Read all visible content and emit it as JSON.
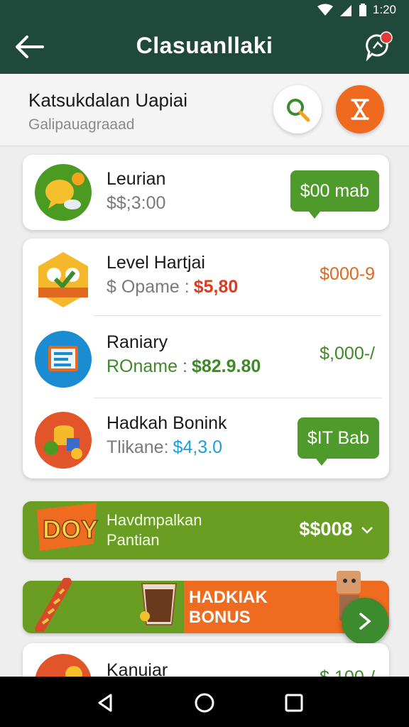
{
  "status_bar": {
    "time": "1:20",
    "icons": [
      "wifi-icon",
      "signal-icon",
      "battery-icon"
    ]
  },
  "app_bar": {
    "title": "Clasuanllaki",
    "back_icon": "back-arrow-icon",
    "action_icon": "chat-notification-icon"
  },
  "header": {
    "title": "Katsukdalan Uapiai",
    "subtitle": "Galipauagraaad",
    "search_icon": "search-icon",
    "hourglass_icon": "hourglass-icon"
  },
  "items": [
    {
      "name": "Leurian",
      "sub_label": "$$;3:00",
      "amount": "$00 mab",
      "amount_style": "bubble",
      "icon": "chat-bubble-icon"
    },
    {
      "name": "Level Hartjai",
      "sub_label": "$ Opame :",
      "sub_value": "$5,80",
      "sub_value_color": "#e0391b",
      "amount": "$000-9",
      "amount_color": "#e0681f",
      "icon": "puzzle-badge-icon"
    },
    {
      "name": "Raniary",
      "sub_label": "ROname :",
      "sub_value": "$82.9.80",
      "sub_value_color": "#3d8a25",
      "amount": "$,000-/",
      "amount_color": "#3d8a25",
      "icon": "document-icon"
    },
    {
      "name": "Hadkah Bonink",
      "sub_label": "Tlikane:",
      "sub_value": "$4,3.0",
      "sub_value_color": "#1aa0d8",
      "amount": "$IT Bab",
      "amount_style": "bubble",
      "icon": "coins-icon"
    }
  ],
  "promo": {
    "badge": "DOY",
    "line1": "Havdmpalkan",
    "line2": "Pantian",
    "amount": "$$008",
    "chevron_icon": "chevron-down-icon"
  },
  "bonus": {
    "line1": "HADKIAK",
    "line2": "BONUS",
    "fab_icon": "chevron-right-icon"
  },
  "partial_item": {
    "name": "Kanuiar",
    "amount": "$.100-/"
  },
  "nav": {
    "back": "nav-back-icon",
    "home": "nav-home-icon",
    "recents": "nav-recents-icon"
  },
  "colors": {
    "app_bar": "#1f4a3b",
    "accent_green": "#4e9a2b",
    "accent_orange": "#ee6b1f"
  }
}
